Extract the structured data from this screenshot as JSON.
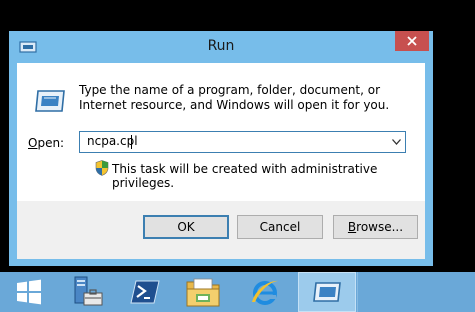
{
  "window": {
    "title": "Run",
    "title_icon": "run-icon",
    "close_icon": "close-icon"
  },
  "dialog": {
    "description": "Type the name of a program, folder, document, or Internet resource, and Windows will open it for you.",
    "open_label": "Open:",
    "open_value": "ncpa.cpl",
    "admin_note": "This task will be created with administrative privileges.",
    "buttons": {
      "ok": "OK",
      "cancel": "Cancel",
      "browse": "Browse..."
    }
  },
  "taskbar": {
    "items": [
      {
        "icon": "start-windows-icon",
        "active": false
      },
      {
        "icon": "server-manager-icon",
        "active": false
      },
      {
        "icon": "powershell-icon",
        "active": false
      },
      {
        "icon": "file-explorer-icon",
        "active": false
      },
      {
        "icon": "internet-explorer-icon",
        "active": false
      },
      {
        "icon": "run-icon",
        "active": true
      }
    ]
  },
  "colors": {
    "window_frame": "#77bdea",
    "close_button": "#c7504f",
    "taskbar": "#6aa8d8",
    "focus_border": "#3c7fb1"
  }
}
